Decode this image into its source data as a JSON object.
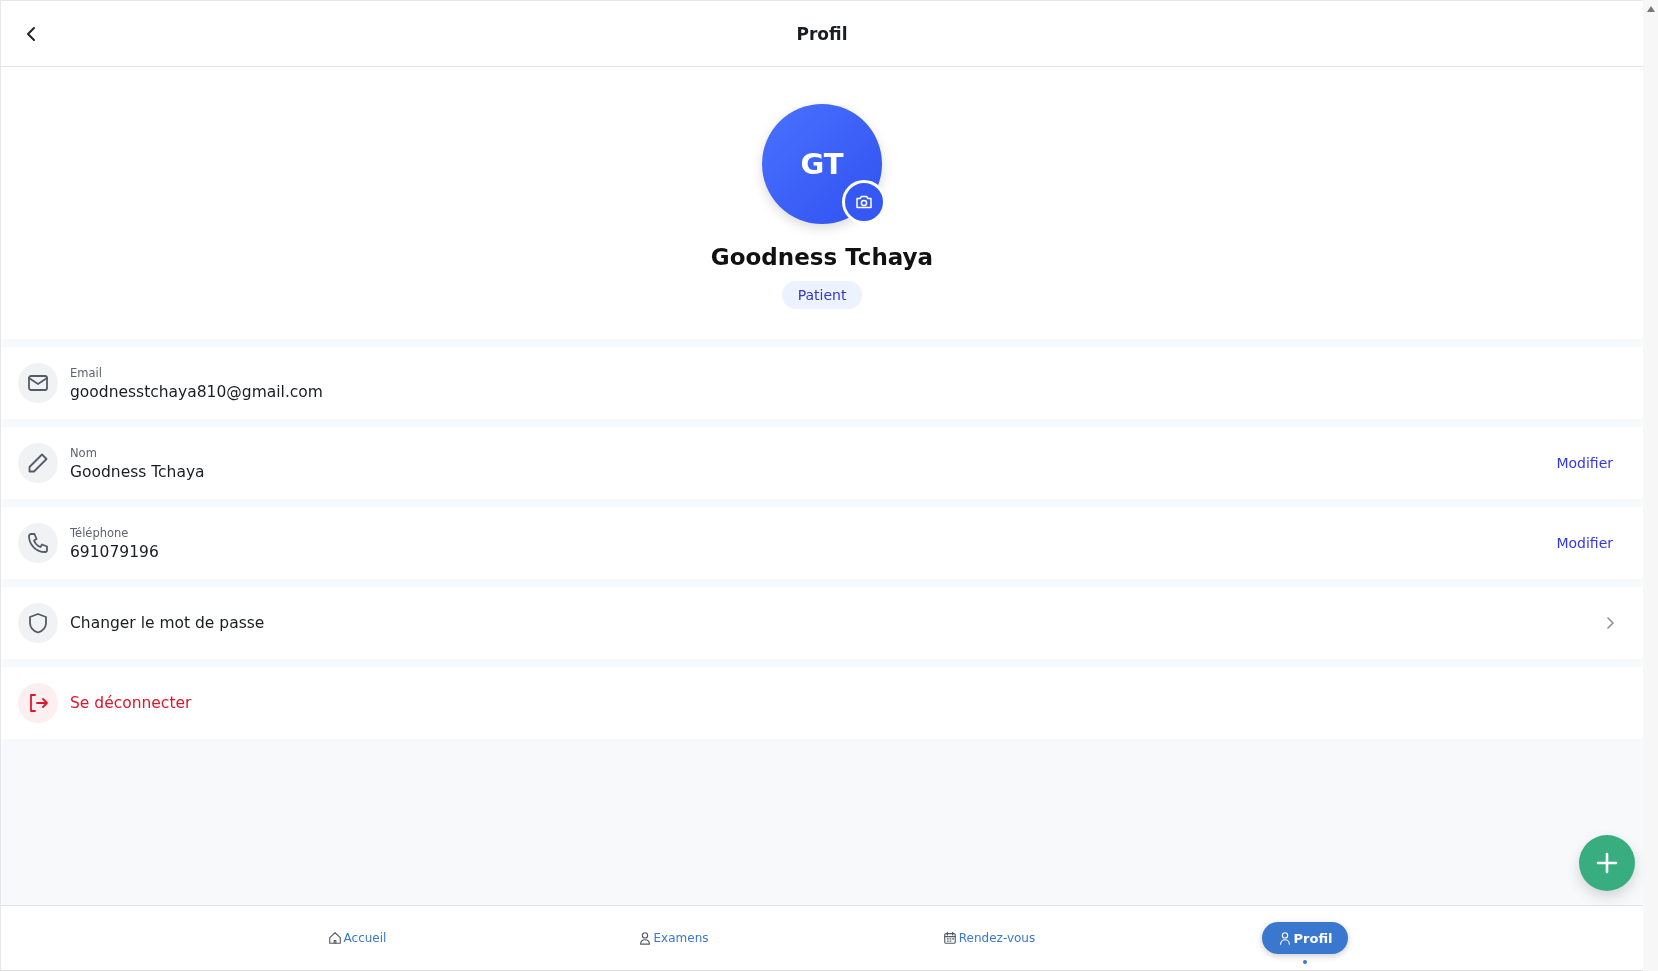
{
  "header": {
    "title": "Profil"
  },
  "profile": {
    "initials": "GT",
    "name": "Goodness Tchaya",
    "role": "Patient"
  },
  "rows": [
    {
      "kind": "info",
      "label": "Email",
      "value": "goodnesstchaya810@gmail.com"
    },
    {
      "kind": "info",
      "label": "Nom",
      "value": "Goodness Tchaya",
      "action": "Modifier"
    },
    {
      "kind": "info",
      "label": "Téléphone",
      "value": "691079196",
      "action": "Modifier"
    },
    {
      "kind": "link",
      "value": "Changer le mot de passe"
    },
    {
      "kind": "danger",
      "value": "Se déconnecter"
    }
  ],
  "nav": [
    {
      "label": "Accueil",
      "selected": false
    },
    {
      "label": "Examens",
      "selected": false
    },
    {
      "label": "Rendez-vous",
      "selected": false
    },
    {
      "label": "Profil",
      "selected": true
    }
  ]
}
